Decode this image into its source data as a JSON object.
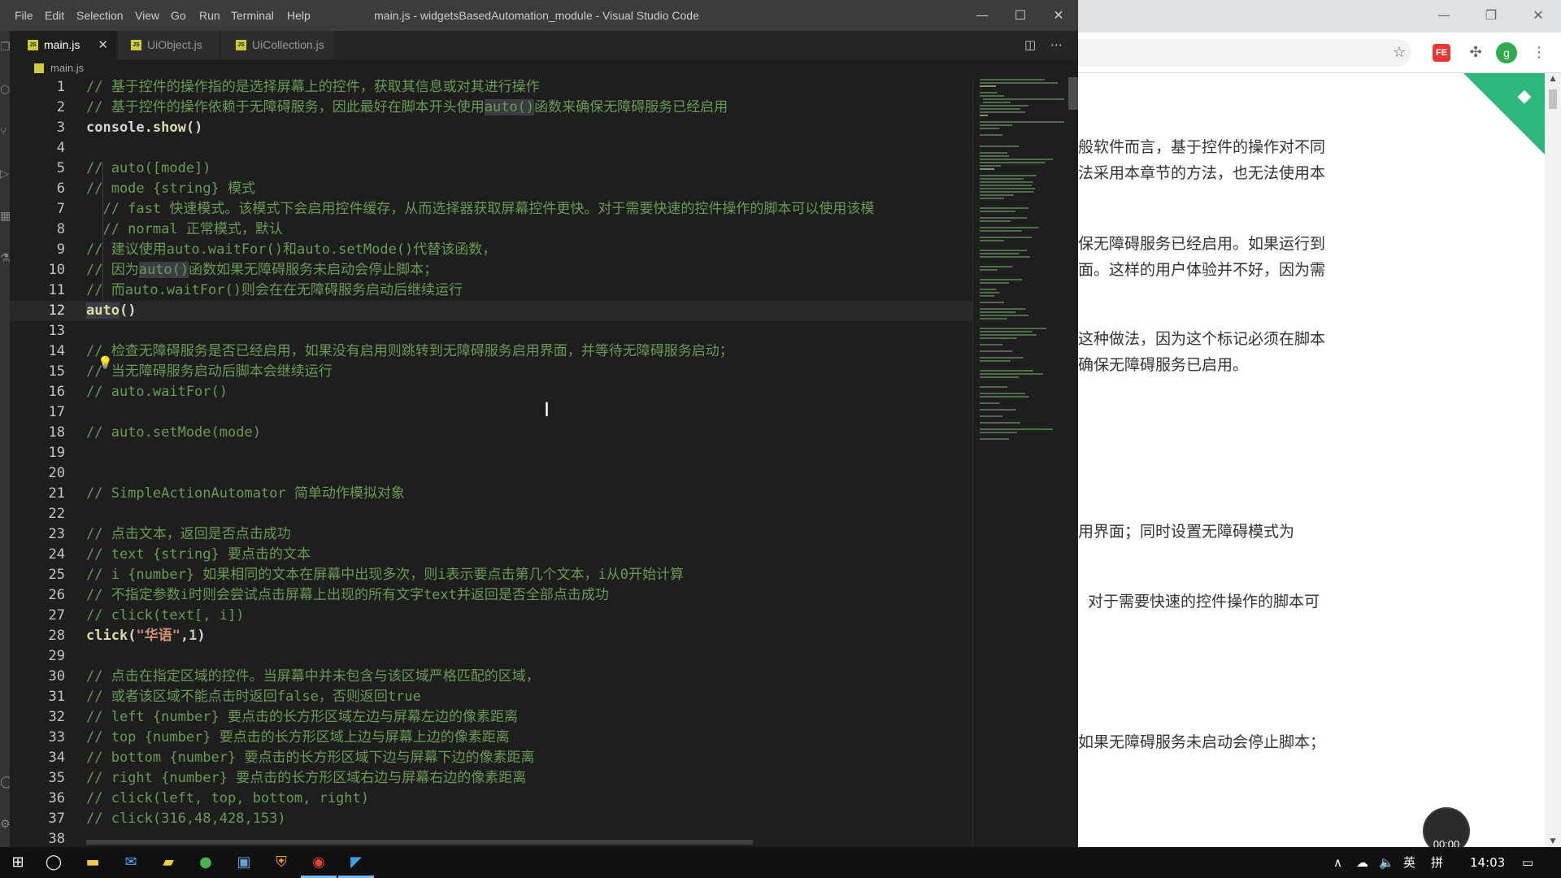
{
  "browser": {
    "doc_lines": [
      "般软件而言，基于控件的操作对不同",
      "法采用本章节的方法，也无法使用本",
      "保无障碍服务已经启用。如果运行到",
      "面。这样的用户体验并不好，因为需",
      "这种做法，因为这个标记必须在脚本",
      "确保无障碍服务已启用。",
      "用界面；同时设置无障碍模式为",
      "对于需要快速的控件操作的脚本可",
      "如果无障碍服务未启动会停止脚本；"
    ],
    "avatar_letter": "g",
    "ext_label": "FE",
    "timer": "00:00"
  },
  "vscode": {
    "menu": [
      "File",
      "Edit",
      "Selection",
      "View",
      "Go",
      "Run",
      "Terminal",
      "Help"
    ],
    "window_title": "main.js - widgetsBasedAutomation_module - Visual Studio Code",
    "tabs": [
      {
        "label": "main.js"
      },
      {
        "label": "UiObject.js"
      },
      {
        "label": "UiCollection.js"
      }
    ],
    "js_badge": "JS",
    "breadcrumb": "main.js",
    "code": {
      "l1": "// 基于控件的操作指的是选择屏幕上的控件，获取其信息或对其进行操作",
      "l2a": "// 基于控件的操作依赖于无障碍服务，因此最好在脚本开头使用",
      "l2b": "auto()",
      "l2c": "函数来确保无障碍服务已经启用",
      "l3a": "console.",
      "l3b": "show",
      "l3c": "()",
      "l5": "// auto([mode])",
      "l6": "// mode {string} 模式",
      "l7": "  // fast 快速模式。该模式下会启用控件缓存，从而选择器获取屏幕控件更快。对于需要快速的控件操作的脚本可以使用该模",
      "l8": "  // normal 正常模式，默认",
      "l9": "// 建议使用auto.waitFor()和auto.setMode()代替该函数，",
      "l10a": "// 因为",
      "l10b": "auto()",
      "l10c": "函数如果无障碍服务未启动会停止脚本；",
      "l11": "// 而auto.waitFor()则会在在无障碍服务启动后继续运行",
      "l12a": "auto",
      "l12b": "()",
      "l14": "// 检查无障碍服务是否已经启用，如果没有启用则跳转到无障碍服务启用界面，并等待无障碍服务启动；",
      "l15": "// 当无障碍服务启动后脚本会继续运行",
      "l16": "// auto.waitFor()",
      "l18": "// auto.setMode(mode)",
      "l21": "// SimpleActionAutomator 简单动作模拟对象",
      "l23": "// 点击文本，返回是否点击成功",
      "l24": "// text {string} 要点击的文本",
      "l25": "// i {number} 如果相同的文本在屏幕中出现多次，则i表示要点击第几个文本，i从0开始计算",
      "l26": "// 不指定参数i时则会尝试点击屏幕上出现的所有文字text并返回是否全部点击成功",
      "l27": "// click(text[, i])",
      "l28a": "click",
      "l28b": "(",
      "l28c": "\"华语\"",
      "l28d": ",",
      "l28e": "1",
      "l28f": ")",
      "l30": "// 点击在指定区域的控件。当屏幕中并未包含与该区域严格匹配的区域，",
      "l31": "// 或者该区域不能点击时返回false，否则返回true",
      "l32": "// left {number} 要点击的长方形区域左边与屏幕左边的像素距离",
      "l33": "// top {number} 要点击的长方形区域上边与屏幕上边的像素距离",
      "l34": "// bottom {number} 要点击的长方形区域下边与屏幕下边的像素距离",
      "l35": "// right {number} 要点击的长方形区域右边与屏幕右边的像素距离",
      "l36": "// click(left, top, bottom, right)",
      "l37": "// click(316,48,428,153)"
    },
    "line_numbers": [
      "1",
      "2",
      "3",
      "4",
      "5",
      "6",
      "7",
      "8",
      "9",
      "10",
      "11",
      "12",
      "13",
      "14",
      "15",
      "16",
      "17",
      "18",
      "19",
      "20",
      "21",
      "22",
      "23",
      "24",
      "25",
      "26",
      "27",
      "28",
      "29",
      "30",
      "31",
      "32",
      "33",
      "34",
      "35",
      "36",
      "37",
      "38"
    ]
  },
  "taskbar": {
    "ime": "英",
    "ime2": "拼",
    "clock": "14:03"
  },
  "colors": {
    "vscode_bg": "#1e1e1e",
    "comment": "#6a9955",
    "titlebar": "#3c3c3c",
    "accent_green": "#2fb67c",
    "taskbar": "#101010"
  },
  "icons": [
    "files-icon",
    "search-icon",
    "source-control-icon",
    "run-icon",
    "extensions-icon",
    "test-icon",
    "account-icon",
    "settings-icon",
    "split-editor-icon",
    "more-actions-icon",
    "star-icon",
    "puzzle-icon",
    "windows-start-icon",
    "cortana-icon",
    "file-explorer-icon",
    "mail-icon",
    "sticky-notes-icon",
    "wechat-icon",
    "chrome-icon",
    "vscode-icon",
    "cloud-icon",
    "volume-icon",
    "notification-icon"
  ]
}
